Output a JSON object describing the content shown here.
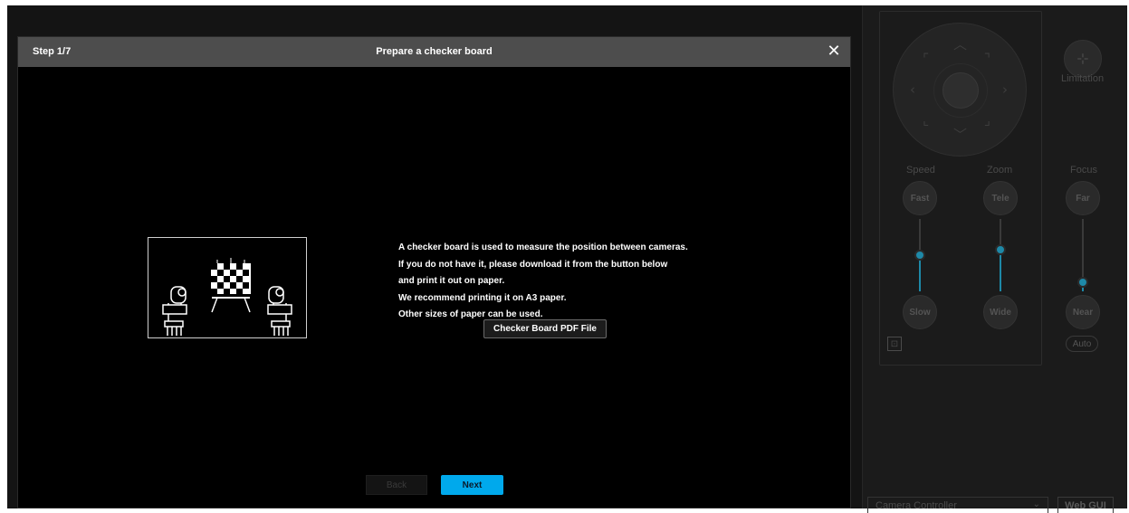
{
  "dialog": {
    "step": "Step 1/7",
    "title": "Prepare a checker board",
    "message_lines": [
      "A checker board is used to measure the position between cameras.",
      "If you do not have it, please download it from the button below",
      "and print it out on paper.",
      "We recommend printing it on A3 paper.",
      "Other sizes of paper can be used."
    ],
    "pdf_button": "Checker Board PDF File",
    "back_button": "Back",
    "next_button": "Next",
    "accent_color": "#00a9ec"
  },
  "panel": {
    "limitation_label": "Limitation",
    "speed_label": "Speed",
    "zoom_label": "Zoom",
    "focus_label": "Focus",
    "fast_button": "Fast",
    "slow_button": "Slow",
    "tele_button": "Tele",
    "wide_button": "Wide",
    "far_button": "Far",
    "near_button": "Near",
    "auto_button": "Auto",
    "controller_select": "Camera Controller",
    "web_gui_button": "Web GUI",
    "speed_level": 0.55,
    "zoom_level": 0.65,
    "focus_level": 0.15
  }
}
